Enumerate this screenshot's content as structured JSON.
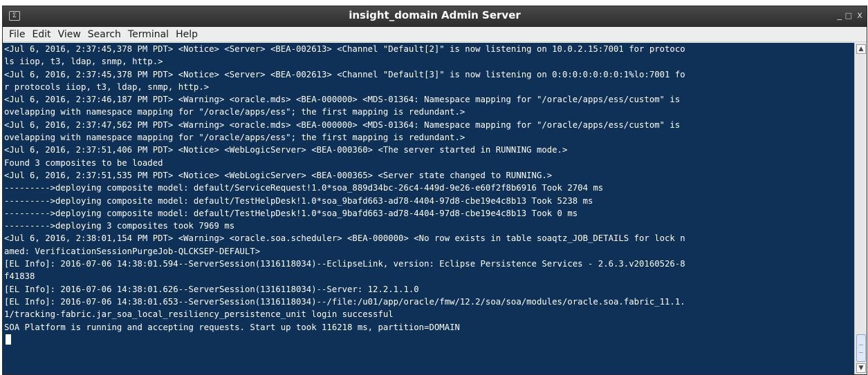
{
  "window": {
    "title": "insight_domain Admin Server",
    "icon": "terminal-icon",
    "controls": {
      "minimize": "_",
      "maximize": "□",
      "close": "x"
    }
  },
  "menu": [
    "File",
    "Edit",
    "View",
    "Search",
    "Terminal",
    "Help"
  ],
  "terminal": {
    "background": "#0f3057",
    "foreground": "#ffffff",
    "lines": [
      "<Jul 6, 2016, 2:37:45,378 PM PDT> <Notice> <Server> <BEA-002613> <Channel \"Default[2]\" is now listening on 10.0.2.15:7001 for protoco",
      "ls iiop, t3, ldap, snmp, http.>",
      "<Jul 6, 2016, 2:37:45,378 PM PDT> <Notice> <Server> <BEA-002613> <Channel \"Default[3]\" is now listening on 0:0:0:0:0:0:0:1%lo:7001 fo",
      "r protocols iiop, t3, ldap, snmp, http.>",
      "<Jul 6, 2016, 2:37:46,187 PM PDT> <Warning> <oracle.mds> <BEA-000000> <MDS-01364: Namespace mapping for \"/oracle/apps/ess/custom\" is",
      "ovelapping with namespace mapping for \"/oracle/apps/ess\"; the first mapping is redundant.>",
      "<Jul 6, 2016, 2:37:47,562 PM PDT> <Warning> <oracle.mds> <BEA-000000> <MDS-01364: Namespace mapping for \"/oracle/apps/ess/custom\" is",
      "ovelapping with namespace mapping for \"/oracle/apps/ess\"; the first mapping is redundant.>",
      "<Jul 6, 2016, 2:37:51,406 PM PDT> <Notice> <WebLogicServer> <BEA-000360> <The server started in RUNNING mode.>",
      "Found 3 composites to be loaded",
      "<Jul 6, 2016, 2:37:51,535 PM PDT> <Notice> <WebLogicServer> <BEA-000365> <Server state changed to RUNNING.>",
      "--------->deploying composite model: default/ServiceRequest!1.0*soa_889d34bc-26c4-449d-9e26-e60f2f8b6916 Took 2704 ms",
      "--------->deploying composite model: default/TestHelpDesk!1.0*soa_9bafd663-ad78-4404-97d8-cbe19e4c8b13 Took 5238 ms",
      "--------->deploying composite model: default/TestHelpDesk!1.0*soa_9bafd663-ad78-4404-97d8-cbe19e4c8b13 Took 0 ms",
      "--------->deploying 3 composites took 7969 ms",
      "<Jul 6, 2016, 2:38:01,154 PM PDT> <Warning> <oracle.soa.scheduler> <BEA-000000> <No row exists in table soaqtz_JOB_DETAILS for lock n",
      "amed: VerificationSessionPurgeJob-QLCKSEP-DEFAULT>",
      "[EL Info]: 2016-07-06 14:38:01.594--ServerSession(1316118034)--EclipseLink, version: Eclipse Persistence Services - 2.6.3.v20160526-8",
      "f41838",
      "[EL Info]: 2016-07-06 14:38:01.626--ServerSession(1316118034)--Server: 12.2.1.1.0",
      "[EL Info]: 2016-07-06 14:38:01.653--ServerSession(1316118034)--/file:/u01/app/oracle/fmw/12.2/soa/soa/modules/oracle.soa.fabric_11.1.",
      "1/tracking-fabric.jar_soa_local_resiliency_persistence_unit login successful",
      "SOA Platform is running and accepting requests. Start up took 116218 ms, partition=DOMAIN",
      ""
    ]
  },
  "scrollbar": {
    "up_icon": "▲",
    "down_icon": "▼"
  }
}
